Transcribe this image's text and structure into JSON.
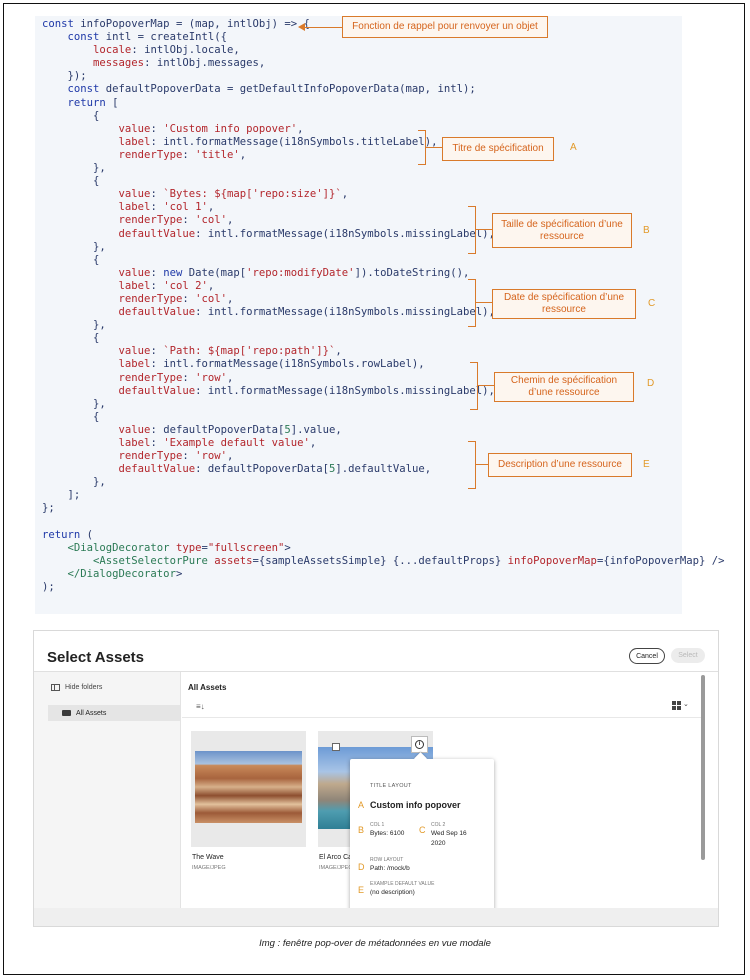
{
  "code_lines": [
    "const infoPopoverMap = (map, intlObj) => {",
    "    const intl = createIntl({",
    "        locale: intlObj.locale,",
    "        messages: intlObj.messages,",
    "    });",
    "    const defaultPopoverData = getDefaultInfoPopoverData(map, intl);",
    "    return [",
    "        {",
    "            value: 'Custom info popover',",
    "            label: intl.formatMessage(i18nSymbols.titleLabel),",
    "            renderType: 'title',",
    "        },",
    "        {",
    "            value: `Bytes: ${map['repo:size']}`,",
    "            label: 'col 1',",
    "            renderType: 'col',",
    "            defaultValue: intl.formatMessage(i18nSymbols.missingLabel),",
    "        },",
    "        {",
    "            value: new Date(map['repo:modifyDate']).toDateString(),",
    "            label: 'col 2',",
    "            renderType: 'col',",
    "            defaultValue: intl.formatMessage(i18nSymbols.missingLabel),",
    "        },",
    "        {",
    "            value: `Path: ${map['repo:path']}`,",
    "            label: intl.formatMessage(i18nSymbols.rowLabel),",
    "            renderType: 'row',",
    "            defaultValue: intl.formatMessage(i18nSymbols.missingLabel),",
    "        },",
    "        {",
    "            value: defaultPopoverData[5].value,",
    "            label: 'Example default value',",
    "            renderType: 'row',",
    "            defaultValue: defaultPopoverData[5].defaultValue,",
    "        },",
    "    ];",
    "};",
    "",
    "return (",
    "    <DialogDecorator type=\"fullscreen\">",
    "        <AssetSelectorPure assets={sampleAssetsSimple} {...defaultProps} infoPopoverMap={infoPopoverMap} />",
    "    </DialogDecorator>",
    ");"
  ],
  "annotations": {
    "arrow_label": "Fonction de rappel pour renvoyer un objet",
    "A": {
      "letter": "A",
      "label": "Titre de spécification"
    },
    "B": {
      "letter": "B",
      "label": "Taille de spécification d’une ressource"
    },
    "C": {
      "letter": "C",
      "label": "Date de spécification d’une ressource"
    },
    "D": {
      "letter": "D",
      "label": "Chemin de spécification d’une ressource"
    },
    "E": {
      "letter": "E",
      "label": "Description d’une ressource"
    }
  },
  "modal": {
    "title": "Select Assets",
    "cancel_label": "Cancel",
    "select_label": "Select",
    "hide_folders_label": "Hide folders",
    "folder_label": "All Assets",
    "main_heading": "All Assets",
    "sort_icon": "sort-icon",
    "view_icon": "grid-view-icon",
    "cards": [
      {
        "name": "The Wave",
        "type": "IMAGE/JPEG"
      },
      {
        "name": "El Arco Cab",
        "type": "IMAGE/JPEG"
      }
    ],
    "popover": {
      "header": "TITLE LAYOUT",
      "title": "Custom info popover",
      "col1_label": "COL 1",
      "col1_value": "Bytes: 6100",
      "col2_label": "COL 2",
      "col2_value_line1": "Wed Sep 16",
      "col2_value_line2": "2020",
      "row_label": "ROW LAYOUT",
      "row_value": "Path: /mock/b",
      "example_label": "EXAMPLE DEFAULT VALUE",
      "example_value": "(no description)"
    }
  },
  "caption": "Img : fenêtre pop-over de métadonnées en vue modale",
  "colors": {
    "annotation": "#d97a2b",
    "letter": "#e29a2a",
    "code_bg": "#f3f6fa"
  }
}
